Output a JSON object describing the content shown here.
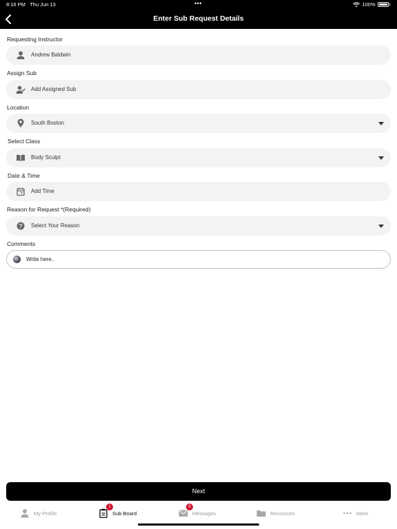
{
  "status": {
    "time": "8:16 PM",
    "date": "Thu Jun 13",
    "battery": "100%",
    "dots": "•••"
  },
  "header": {
    "title": "Enter Sub Request Details"
  },
  "form": {
    "instructor": {
      "label": "Requesting Instructor",
      "value": "Andrew Baldwin",
      "icon": "person-icon"
    },
    "assign": {
      "label": "Assign Sub",
      "placeholder": "Add Assigned Sub",
      "icon": "person-check-icon"
    },
    "location": {
      "label": "Location",
      "value": "South Boston",
      "icon": "location-pin-icon"
    },
    "class": {
      "label": "Select Class",
      "value": "Body Sculpt",
      "icon": "book-icon"
    },
    "datetime": {
      "label": "Date & Time",
      "placeholder": "Add Time",
      "icon": "calendar-icon"
    },
    "reason": {
      "label": "Reason for Request *(Required)",
      "placeholder": "Select Your Reason",
      "icon": "question-icon"
    },
    "comments": {
      "label": "Comments",
      "placeholder": "Write here.."
    }
  },
  "next_label": "Next",
  "tabs": [
    {
      "label": "My Profile",
      "icon": "person-icon",
      "badge": ""
    },
    {
      "label": "Sub Board",
      "icon": "clipboard-icon",
      "badge": "1"
    },
    {
      "label": "Messages",
      "icon": "envelope-icon",
      "badge": "6"
    },
    {
      "label": "Resources",
      "icon": "folder-icon",
      "badge": ""
    },
    {
      "label": "More",
      "icon": "more-icon",
      "badge": ""
    }
  ],
  "colors": {
    "header_bg": "#000000",
    "field_bg": "#f3f3f3",
    "badge": "#d0112b"
  }
}
